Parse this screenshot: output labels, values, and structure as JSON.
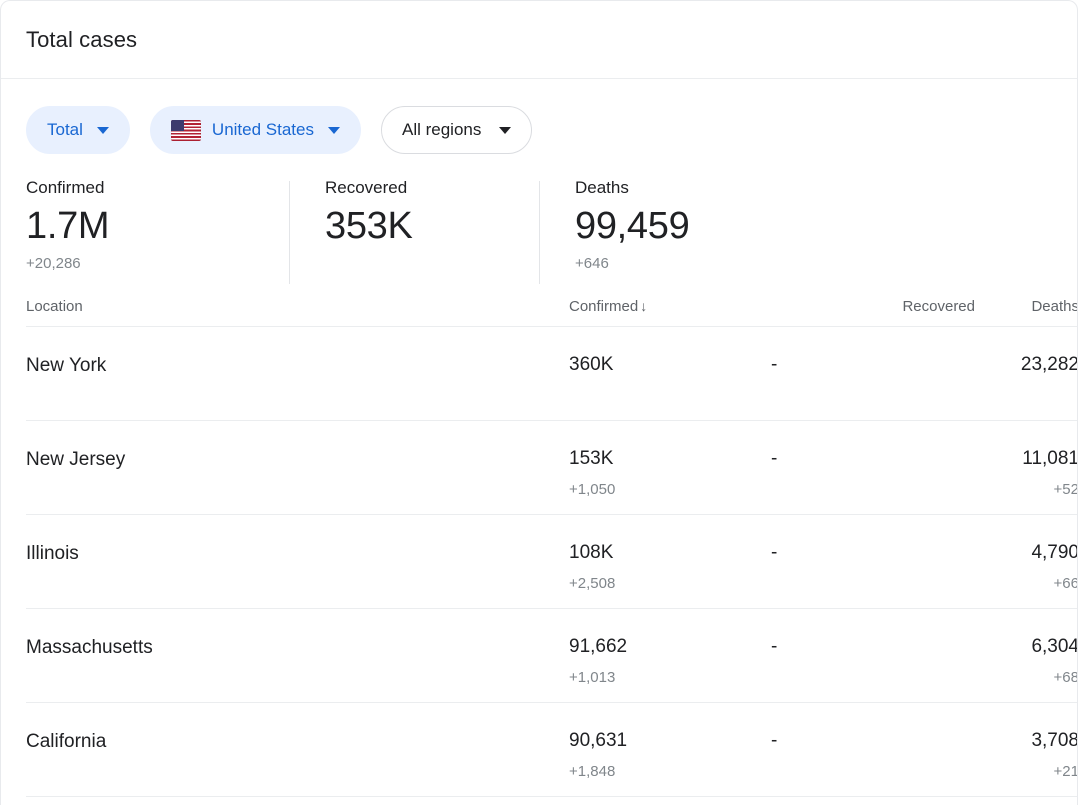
{
  "header": {
    "title": "Total cases"
  },
  "filters": [
    {
      "id": "metric",
      "label": "Total",
      "style": "blue",
      "icon": "chevron-down-icon",
      "flag": null
    },
    {
      "id": "country",
      "label": "United States",
      "style": "blue",
      "icon": "chevron-down-icon",
      "flag": "us-flag-icon"
    },
    {
      "id": "region",
      "label": "All regions",
      "style": "white",
      "icon": "chevron-down-icon",
      "flag": null
    }
  ],
  "summary": [
    {
      "id": "confirmed",
      "label": "Confirmed",
      "value": "1.7M",
      "delta": "+20,286"
    },
    {
      "id": "recovered",
      "label": "Recovered",
      "value": "353K",
      "delta": ""
    },
    {
      "id": "deaths",
      "label": "Deaths",
      "value": "99,459",
      "delta": "+646"
    }
  ],
  "table": {
    "columns": {
      "location": "Location",
      "confirmed": "Confirmed",
      "confirmed_sort_icon": "↓",
      "recovered": "Recovered",
      "deaths": "Deaths"
    },
    "rows": [
      {
        "location": "New York",
        "confirmed": "360K",
        "confirmed_delta": "",
        "recovered": "-",
        "deaths": "23,282",
        "deaths_delta": ""
      },
      {
        "location": "New Jersey",
        "confirmed": "153K",
        "confirmed_delta": "+1,050",
        "recovered": "-",
        "deaths": "11,081",
        "deaths_delta": "+52"
      },
      {
        "location": "Illinois",
        "confirmed": "108K",
        "confirmed_delta": "+2,508",
        "recovered": "-",
        "deaths": "4,790",
        "deaths_delta": "+66"
      },
      {
        "location": "Massachusetts",
        "confirmed": "91,662",
        "confirmed_delta": "+1,013",
        "recovered": "-",
        "deaths": "6,304",
        "deaths_delta": "+68"
      },
      {
        "location": "California",
        "confirmed": "90,631",
        "confirmed_delta": "+1,848",
        "recovered": "-",
        "deaths": "3,708",
        "deaths_delta": "+21"
      }
    ]
  },
  "colors": {
    "chip_blue_bg": "#e8f0fe",
    "chip_blue_text": "#1967d2",
    "text_primary": "#202124",
    "text_secondary": "#5f6368",
    "text_muted": "#80868b",
    "divider": "#ebedef",
    "flag_blue": "#3c3b6e",
    "flag_red": "#b22234"
  }
}
